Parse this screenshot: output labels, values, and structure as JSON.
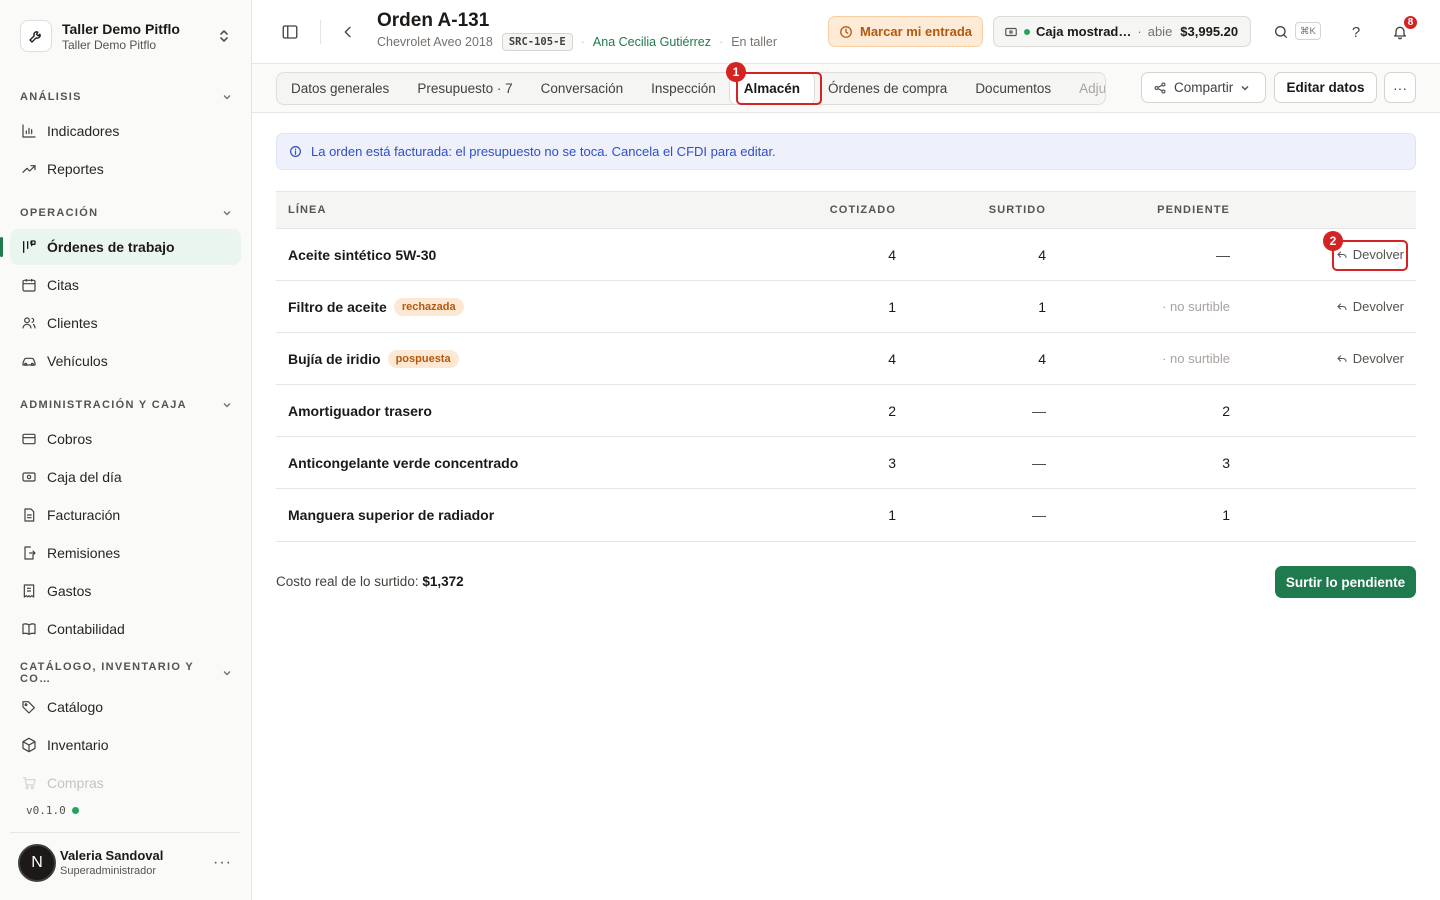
{
  "workspace": {
    "name": "Taller Demo Pitflo",
    "subtitle": "Taller Demo Pitflo"
  },
  "sidebar": {
    "sections": [
      {
        "label": "ANÁLISIS",
        "items": [
          {
            "label": "Indicadores",
            "icon": "bar-chart-icon"
          },
          {
            "label": "Reportes",
            "icon": "trend-icon"
          }
        ]
      },
      {
        "label": "OPERACIÓN",
        "items": [
          {
            "label": "Órdenes de trabajo",
            "icon": "kanban-icon",
            "active": true
          },
          {
            "label": "Citas",
            "icon": "calendar-icon"
          },
          {
            "label": "Clientes",
            "icon": "users-icon"
          },
          {
            "label": "Vehículos",
            "icon": "car-icon"
          }
        ]
      },
      {
        "label": "ADMINISTRACIÓN Y CAJA",
        "items": [
          {
            "label": "Cobros",
            "icon": "card-icon"
          },
          {
            "label": "Caja del día",
            "icon": "cash-icon"
          },
          {
            "label": "Facturación",
            "icon": "file-icon"
          },
          {
            "label": "Remisiones",
            "icon": "file-export-icon"
          },
          {
            "label": "Gastos",
            "icon": "receipt-icon"
          },
          {
            "label": "Contabilidad",
            "icon": "book-icon"
          }
        ]
      },
      {
        "label": "CATÁLOGO, INVENTARIO Y CO…",
        "items": [
          {
            "label": "Catálogo",
            "icon": "tags-icon"
          },
          {
            "label": "Inventario",
            "icon": "box-icon"
          },
          {
            "label": "Compras",
            "icon": "cart-icon"
          }
        ]
      }
    ],
    "version": "v0.1.0",
    "user": {
      "initial": "N",
      "name": "Valeria Sandoval",
      "role": "Superadministrador"
    }
  },
  "header": {
    "title": "Orden A-131",
    "vehicle": "Chevrolet Aveo 2018",
    "plate": "SRC-105-E",
    "client": "Ana Cecilia Gutiérrez",
    "status": "En taller",
    "entrada_label": "Marcar mi entrada",
    "caja": {
      "name": "Caja mostrad…",
      "state": "abie",
      "amount": "$3,995.20"
    },
    "shortcut": "⌘K",
    "notifications": "8"
  },
  "tabs": [
    {
      "label": "Datos generales"
    },
    {
      "label": "Presupuesto · 7"
    },
    {
      "label": "Conversación"
    },
    {
      "label": "Inspección"
    },
    {
      "label": "Almacén",
      "active": true
    },
    {
      "label": "Órdenes de compra"
    },
    {
      "label": "Documentos"
    },
    {
      "label": "Adjuntos"
    }
  ],
  "actions": {
    "share": "Compartir",
    "edit": "Editar datos"
  },
  "alert": "La orden está facturada: el presupuesto no se toca. Cancela el CFDI para editar.",
  "table": {
    "headers": {
      "line": "LÍNEA",
      "quoted": "COTIZADO",
      "supplied": "SURTIDO",
      "pending": "PENDIENTE"
    },
    "rows": [
      {
        "name": "Aceite sintético 5W-30",
        "tag": "",
        "quoted": "4",
        "supplied": "4",
        "pending": "—",
        "action": "Devolver"
      },
      {
        "name": "Filtro de aceite",
        "tag": "rechazada",
        "quoted": "1",
        "supplied": "1",
        "pending": "· no surtible",
        "action": "Devolver"
      },
      {
        "name": "Bujía de iridio",
        "tag": "pospuesta",
        "quoted": "4",
        "supplied": "4",
        "pending": "· no surtible",
        "action": "Devolver"
      },
      {
        "name": "Amortiguador trasero",
        "tag": "",
        "quoted": "2",
        "supplied": "—",
        "pending": "2",
        "action": ""
      },
      {
        "name": "Anticongelante verde concentrado",
        "tag": "",
        "quoted": "3",
        "supplied": "—",
        "pending": "3",
        "action": ""
      },
      {
        "name": "Manguera superior de radiador",
        "tag": "",
        "quoted": "1",
        "supplied": "—",
        "pending": "1",
        "action": ""
      }
    ]
  },
  "footer": {
    "cost_label": "Costo real de lo surtido:",
    "cost_value": "$1,372",
    "supply_button": "Surtir lo pendiente"
  },
  "annotations": [
    {
      "label": "1"
    },
    {
      "label": "2"
    }
  ],
  "colors": {
    "accent": "#1f7a4d",
    "warning": "#b4580c",
    "annotation": "#d32323",
    "info": "#2f4fc4"
  }
}
